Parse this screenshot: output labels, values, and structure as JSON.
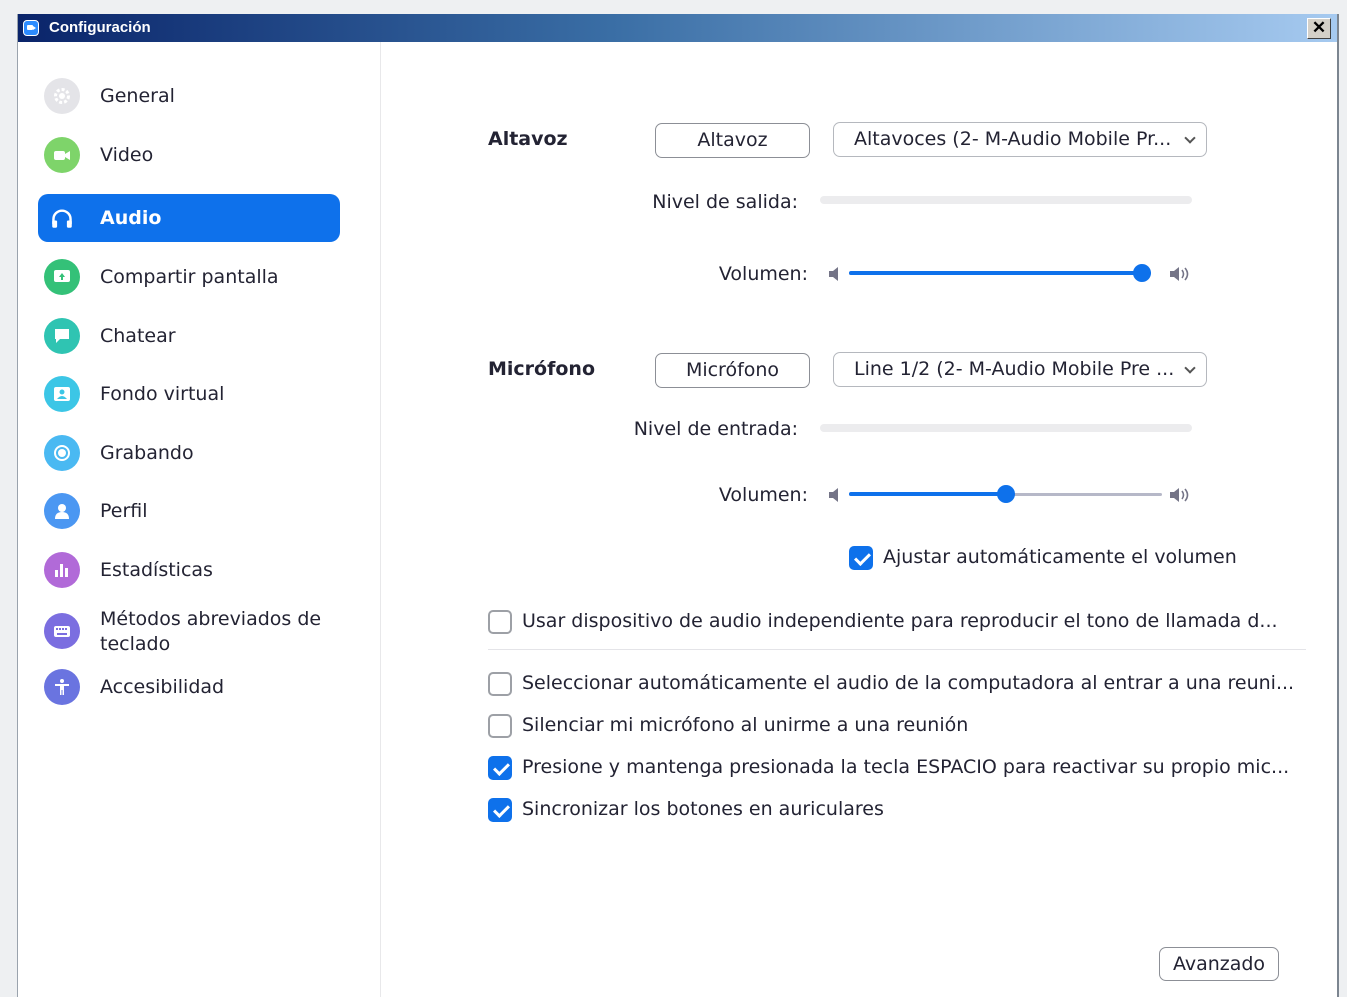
{
  "window": {
    "title": "Configuración"
  },
  "sidebar": {
    "items": [
      {
        "label": "General",
        "icon": "gear-icon",
        "color": "#e8e8ec"
      },
      {
        "label": "Video",
        "icon": "video-camera-icon",
        "color": "#7ed46a"
      },
      {
        "label": "Audio",
        "icon": "headphones-icon",
        "color": "#0e71eb",
        "active": true
      },
      {
        "label": "Compartir pantalla",
        "icon": "share-screen-icon",
        "color": "#34c178"
      },
      {
        "label": "Chatear",
        "icon": "chat-bubble-icon",
        "color": "#2fc4b2"
      },
      {
        "label": "Fondo virtual",
        "icon": "virtual-background-icon",
        "color": "#3cc6e6"
      },
      {
        "label": "Grabando",
        "icon": "record-icon",
        "color": "#4ab9f2"
      },
      {
        "label": "Perfil",
        "icon": "profile-icon",
        "color": "#4b97f2"
      },
      {
        "label": "Estadísticas",
        "icon": "statistics-icon",
        "color": "#b16ad8"
      },
      {
        "label": "Métodos abreviados de teclado",
        "icon": "keyboard-icon",
        "color": "#7b6ee0"
      },
      {
        "label": "Accesibilidad",
        "icon": "accessibility-icon",
        "color": "#6a74e0"
      }
    ]
  },
  "speaker": {
    "section_label": "Altavoz",
    "test_button": "Altavoz",
    "device": "Altavoces (2- M-Audio Mobile Pr...",
    "level_label": "Nivel de salida:",
    "volume_label": "Volumen:",
    "volume": 1.0
  },
  "microphone": {
    "section_label": "Micrófono",
    "test_button": "Micrófono",
    "device": "Line 1/2 (2- M-Audio Mobile Pre ...",
    "level_label": "Nivel de entrada:",
    "volume_label": "Volumen:",
    "volume": 0.5,
    "auto_adjust": {
      "label": "Ajustar automáticamente el volumen",
      "checked": true
    }
  },
  "options": [
    {
      "label": "Usar dispositivo de audio independiente para reproducir el tono de llamada d...",
      "checked": false
    },
    {
      "label": "Seleccionar automáticamente el audio de la computadora al entrar a una reuni...",
      "checked": false
    },
    {
      "label": "Silenciar mi micrófono al unirme a una reunión",
      "checked": false
    },
    {
      "label": "Presione y mantenga presionada la tecla ESPACIO para reactivar su propio mic...",
      "checked": true
    },
    {
      "label": "Sincronizar los botones en auriculares",
      "checked": true
    }
  ],
  "advanced_button": "Avanzado",
  "colors": {
    "accent": "#0e71eb"
  }
}
